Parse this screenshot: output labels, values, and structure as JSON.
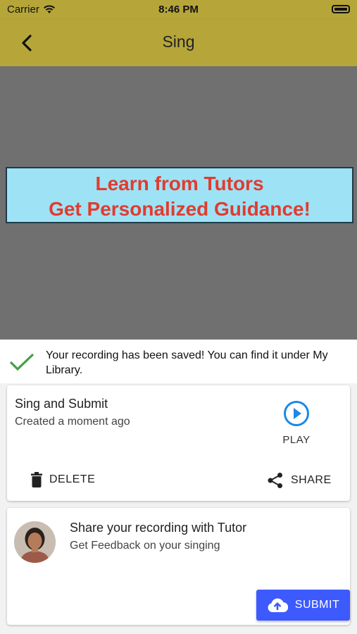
{
  "status": {
    "carrier": "Carrier",
    "time": "8:46 PM"
  },
  "appbar": {
    "title": "Sing",
    "back_icon": "chevron-left-icon"
  },
  "banner": {
    "line1": "Learn from Tutors",
    "line2": "Get Personalized Guidance!"
  },
  "saved_message": "Your recording has been saved! You can find it under My Library.",
  "recording": {
    "title": "Sing and Submit",
    "subtitle": "Created a moment ago",
    "play_label": "PLAY",
    "delete_label": "DELETE",
    "share_label": "SHARE"
  },
  "tutor": {
    "title": "Share your recording with Tutor",
    "subtitle": "Get Feedback on your singing",
    "submit_label": "SUBMIT"
  },
  "colors": {
    "appbar": "#b6a63a",
    "banner_bg": "#9ee2f6",
    "banner_text": "#e23b2e",
    "accent": "#3d5afe",
    "play": "#1e88e5",
    "check": "#43a047"
  }
}
